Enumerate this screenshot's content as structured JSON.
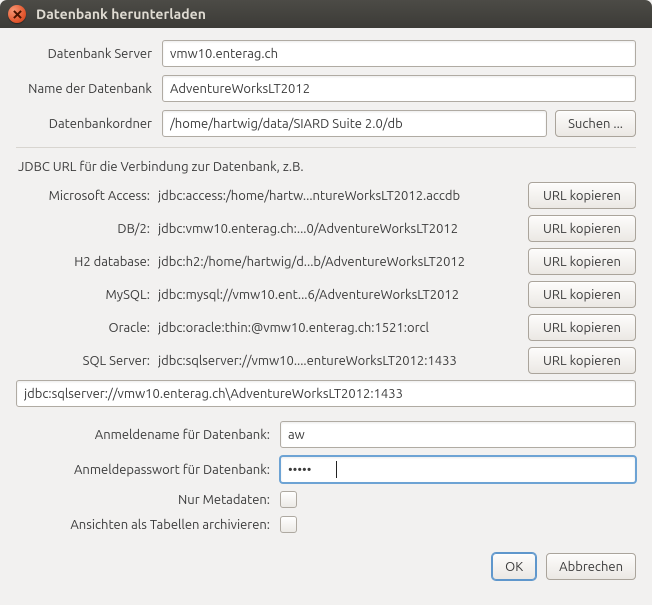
{
  "title": "Datenbank herunterladen",
  "top": {
    "server_label": "Datenbank Server",
    "server_value": "vmw10.enterag.ch",
    "dbname_label": "Name der Datenbank",
    "dbname_value": "AdventureWorksLT2012",
    "folder_label": "Datenbankordner",
    "folder_value": "/home/hartwig/data/SIARD Suite 2.0/db",
    "browse_label": "Suchen ..."
  },
  "jdbc": {
    "heading": "JDBC URL für die Verbindung zur Datenbank, z.B.",
    "rows": [
      {
        "label": "Microsoft Access:",
        "url": "jdbc:access:/home/hartw...ntureWorksLT2012.accdb"
      },
      {
        "label": "DB/2:",
        "url": "jdbc:vmw10.enterag.ch:...0/AdventureWorksLT2012"
      },
      {
        "label": "H2 database:",
        "url": "jdbc:h2:/home/hartwig/d...b/AdventureWorksLT2012"
      },
      {
        "label": "MySQL:",
        "url": "jdbc:mysql://vmw10.ent...6/AdventureWorksLT2012"
      },
      {
        "label": "Oracle:",
        "url": "jdbc:oracle:thin:@vmw10.enterag.ch:1521:orcl"
      },
      {
        "label": "SQL Server:",
        "url": "jdbc:sqlserver://vmw10....entureWorksLT2012:1433"
      }
    ],
    "copy_label": "URL kopieren",
    "value": "jdbc:sqlserver://vmw10.enterag.ch\\AdventureWorksLT2012:1433"
  },
  "login": {
    "user_label": "Anmeldename für Datenbank:",
    "user_value": "aw",
    "pass_label": "Anmeldepasswort für Datenbank:",
    "pass_value": "•••••",
    "meta_label": "Nur Metadaten:",
    "views_label": "Ansichten als Tabellen archivieren:"
  },
  "buttons": {
    "ok": "OK",
    "cancel": "Abbrechen"
  }
}
